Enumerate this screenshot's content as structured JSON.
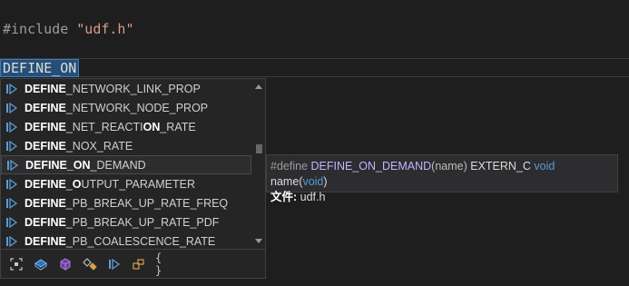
{
  "editor": {
    "include_directive": "#include",
    "include_file": "\"udf.h\"",
    "current_text": "DEFINE_ON"
  },
  "suggestions": [
    {
      "bold": "DEFINE",
      "rest": "_NETWORK_LINK_PROP",
      "selected": false
    },
    {
      "bold": "DEFINE",
      "rest": "_NETWORK_NODE_PROP",
      "selected": false
    },
    {
      "bold": "DEFINE",
      "rest": "_NET_REACTI",
      "bold2": "ON",
      "rest2": "_RATE",
      "selected": false
    },
    {
      "bold": "DEFINE",
      "rest": "_NOX_RATE",
      "selected": false
    },
    {
      "bold": "DEFINE_ON",
      "rest": "_DEMAND",
      "selected": true
    },
    {
      "bold": "DEFINE",
      "rest": "_",
      "bold2": "O",
      "rest2": "UTPUT_PARAMETER",
      "selected": false
    },
    {
      "bold": "DEFINE",
      "rest": "_PB_BREAK_UP_RATE_FREQ",
      "selected": false
    },
    {
      "bold": "DEFINE",
      "rest": "_PB_BREAK_UP_RATE_PDF",
      "selected": false
    },
    {
      "bold": "DEFINE",
      "rest": "_PB_COALESCENCE_RATE",
      "selected": false
    }
  ],
  "tooltip": {
    "define_kw": "#define",
    "name": "DEFINE_ON_DEMAND",
    "param": "(name)",
    "extern": "EXTERN_C",
    "void1": "void",
    "fn": "name(",
    "void2": "void",
    "close": ")",
    "file_label": "文件:",
    "file_name": "udf.h"
  },
  "filters": [
    {
      "icon": "expand-icon"
    },
    {
      "icon": "variable-icon"
    },
    {
      "icon": "cube-icon"
    },
    {
      "icon": "enum-icon"
    },
    {
      "icon": "macro-icon"
    },
    {
      "icon": "class-icon"
    },
    {
      "icon": "braces-icon",
      "text": "{ }"
    }
  ],
  "colors": {
    "macro_icon": "#5b9bd5",
    "selection": "#264f78",
    "tooltip_keyword": "#569cd6",
    "tooltip_name": "#bdb7ff"
  }
}
